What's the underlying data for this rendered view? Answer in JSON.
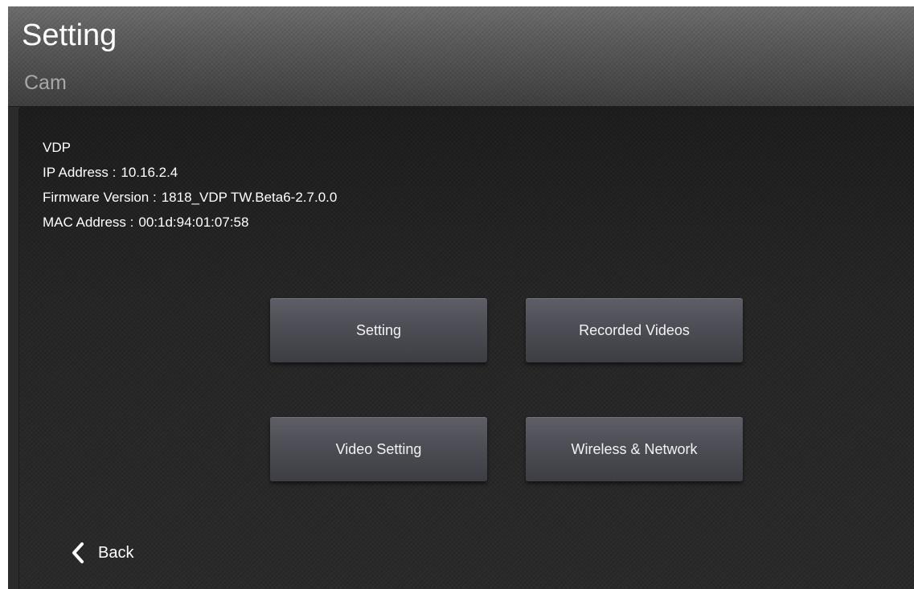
{
  "header": {
    "title": "Setting",
    "subtitle": "Cam"
  },
  "device_info": {
    "name": "VDP",
    "ip_label": "IP Address :",
    "ip_value": "10.16.2.4",
    "firmware_label": "Firmware Version :",
    "firmware_value": "1818_VDP TW.Beta6-2.7.0.0",
    "mac_label": "MAC Address :",
    "mac_value": "00:1d:94:01:07:58"
  },
  "menu": {
    "setting": "Setting",
    "recorded_videos": "Recorded Videos",
    "video_setting": "Video Setting",
    "wireless_network": "Wireless & Network"
  },
  "footer": {
    "back_label": "Back",
    "back_icon": "chevron-left-icon"
  }
}
